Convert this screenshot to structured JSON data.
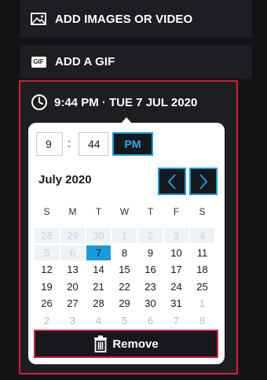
{
  "actions": {
    "add_media_label": "ADD IMAGES OR VIDEO",
    "add_gif_label": "ADD A GIF",
    "gif_badge": "GIF"
  },
  "schedule": {
    "summary": "9:44 PM · TUE 7 JUL 2020"
  },
  "time": {
    "hour": "9",
    "separator": ":",
    "minute": "44",
    "meridiem": "PM"
  },
  "calendar": {
    "month_label": "July 2020",
    "weekdays": [
      "S",
      "M",
      "T",
      "W",
      "T",
      "F",
      "S"
    ],
    "weeks": [
      [
        {
          "d": "28",
          "s": "dis"
        },
        {
          "d": "29",
          "s": "dis"
        },
        {
          "d": "30",
          "s": "dis"
        },
        {
          "d": "1",
          "s": "dis"
        },
        {
          "d": "2",
          "s": "dis"
        },
        {
          "d": "3",
          "s": "dis"
        },
        {
          "d": "4",
          "s": "dis"
        }
      ],
      [
        {
          "d": "5",
          "s": "dis"
        },
        {
          "d": "6",
          "s": "dis"
        },
        {
          "d": "7",
          "s": "sel"
        },
        {
          "d": "8",
          "s": ""
        },
        {
          "d": "9",
          "s": ""
        },
        {
          "d": "10",
          "s": ""
        },
        {
          "d": "11",
          "s": ""
        }
      ],
      [
        {
          "d": "12",
          "s": ""
        },
        {
          "d": "13",
          "s": ""
        },
        {
          "d": "14",
          "s": ""
        },
        {
          "d": "15",
          "s": ""
        },
        {
          "d": "16",
          "s": ""
        },
        {
          "d": "17",
          "s": ""
        },
        {
          "d": "18",
          "s": ""
        }
      ],
      [
        {
          "d": "19",
          "s": ""
        },
        {
          "d": "20",
          "s": ""
        },
        {
          "d": "21",
          "s": ""
        },
        {
          "d": "22",
          "s": ""
        },
        {
          "d": "23",
          "s": ""
        },
        {
          "d": "24",
          "s": ""
        },
        {
          "d": "25",
          "s": ""
        }
      ],
      [
        {
          "d": "26",
          "s": ""
        },
        {
          "d": "27",
          "s": ""
        },
        {
          "d": "28",
          "s": ""
        },
        {
          "d": "29",
          "s": ""
        },
        {
          "d": "30",
          "s": ""
        },
        {
          "d": "31",
          "s": ""
        },
        {
          "d": "1",
          "s": "adj"
        }
      ],
      [
        {
          "d": "2",
          "s": "adj"
        },
        {
          "d": "3",
          "s": "adj"
        },
        {
          "d": "4",
          "s": "adj"
        },
        {
          "d": "5",
          "s": "adj"
        },
        {
          "d": "6",
          "s": "adj"
        },
        {
          "d": "7",
          "s": "adj"
        },
        {
          "d": "8",
          "s": "adj"
        }
      ]
    ],
    "prev_icon": "chevron-left-icon",
    "next_icon": "chevron-right-icon"
  },
  "remove_label": "Remove",
  "colors": {
    "accent_blue": "#1a9bdc",
    "accent_red": "#d21f3c",
    "panel_dark": "#1d1e21",
    "background": "#131315"
  }
}
